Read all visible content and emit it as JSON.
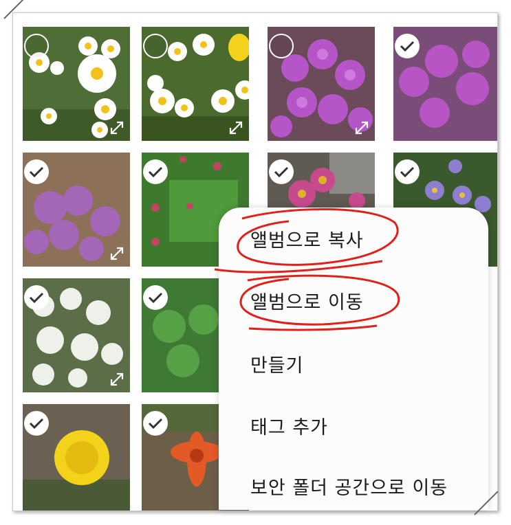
{
  "menu": {
    "items": [
      {
        "label": "앨범으로 복사",
        "annotated": true
      },
      {
        "label": "앨범으로 이동",
        "annotated": true
      },
      {
        "label": "만들기"
      },
      {
        "label": "태그 추가"
      },
      {
        "label": "보안 폴더 공간으로 이동"
      }
    ]
  },
  "photos": [
    {
      "subject": "white daisies",
      "selected": false
    },
    {
      "subject": "white daisies and yellow pansy",
      "selected": false
    },
    {
      "subject": "purple phlox",
      "selected": false
    },
    {
      "subject": "purple phlox",
      "selected": true
    },
    {
      "subject": "pink moss phlox",
      "selected": true
    },
    {
      "subject": "green plant with red buds",
      "selected": true
    },
    {
      "subject": "pink asters",
      "selected": true
    },
    {
      "subject": "purple asters",
      "selected": true
    },
    {
      "subject": "white small flowers",
      "selected": true
    },
    {
      "subject": "green leaves",
      "selected": true
    },
    {
      "subject": "yellow dandelion",
      "selected": true
    },
    {
      "subject": "orange lily",
      "selected": true
    }
  ],
  "colors": {
    "annotation": "#e0201a",
    "menu_background": "#fcfcfc",
    "check": "#333333"
  },
  "icons": {
    "selection": "check-circle-icon",
    "expand": "expand-icon"
  }
}
